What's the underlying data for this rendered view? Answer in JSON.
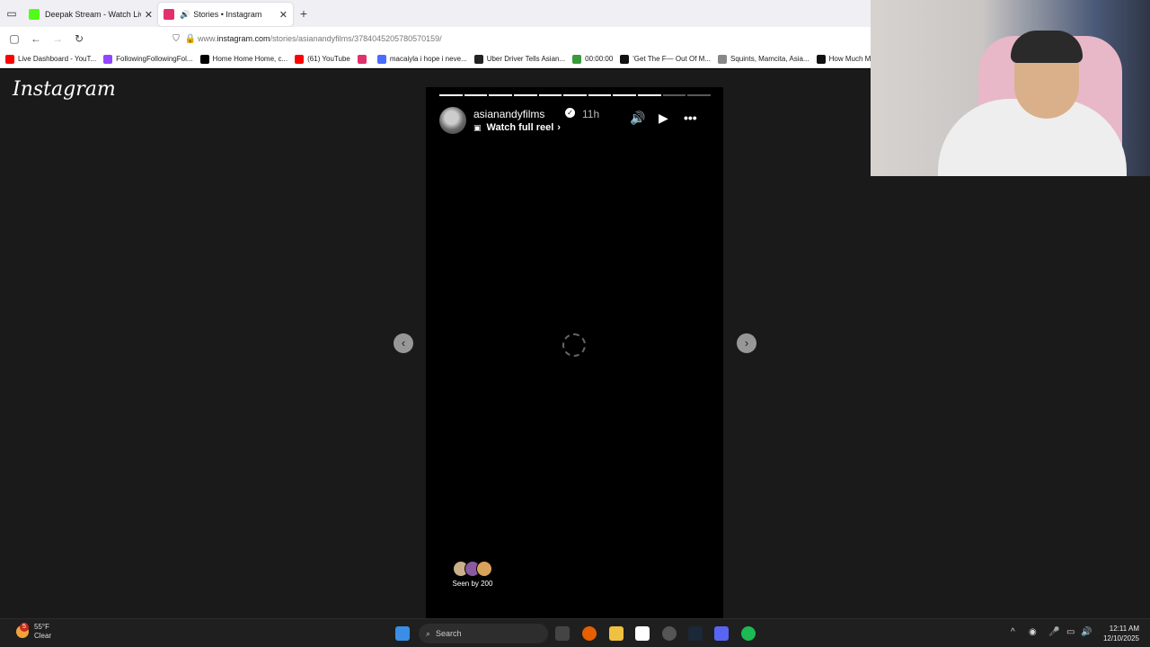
{
  "tabs": [
    {
      "title": "Deepak Stream - Watch Live on",
      "favicon_color": "#53fc18",
      "active": false
    },
    {
      "title": "Stories • Instagram",
      "favicon_color": "#e1306c",
      "active": true
    }
  ],
  "address": {
    "prefix": "www.",
    "host": "instagram.com",
    "path": "/stories/asianandyfilms/3784045205780570159/"
  },
  "bookmarks": [
    {
      "label": "Live Dashboard - YouT...",
      "color": "#ff0000"
    },
    {
      "label": "FollowingFollowingFol...",
      "color": "#9146ff"
    },
    {
      "label": "Home Home Home, c...",
      "color": "#000000"
    },
    {
      "label": "(61) YouTube",
      "color": "#ff0000"
    },
    {
      "label": "",
      "color": "#e1306c"
    },
    {
      "label": "macaiyla i hope i neve...",
      "color": "#4a6cff"
    },
    {
      "label": "Uber Driver Tells Asian...",
      "color": "#222222"
    },
    {
      "label": "00:00:00",
      "color": "#3a9a3a"
    },
    {
      "label": "'Get The F— Out Of M...",
      "color": "#111111"
    },
    {
      "label": "Squints, Mamcita, Asia...",
      "color": "#888888"
    },
    {
      "label": "How Much Money",
      "color": "#111111"
    }
  ],
  "brand": "Instagram",
  "story": {
    "username": "asianandyfilms",
    "verified_icon": "verified-badge-icon",
    "time": "11h",
    "reel_link": "Watch full reel",
    "segments_total": 11,
    "segments_done": 9,
    "seen_text": "Seen by 200",
    "seen_avatar_colors": [
      "#c9b08a",
      "#8a5aa0",
      "#d9a25a"
    ]
  },
  "taskbar": {
    "weather_temp": "55°F",
    "weather_desc": "Clear",
    "weather_badge": "5",
    "search_label": "Search",
    "time": "12:11 AM",
    "date": "12/10/2025"
  }
}
